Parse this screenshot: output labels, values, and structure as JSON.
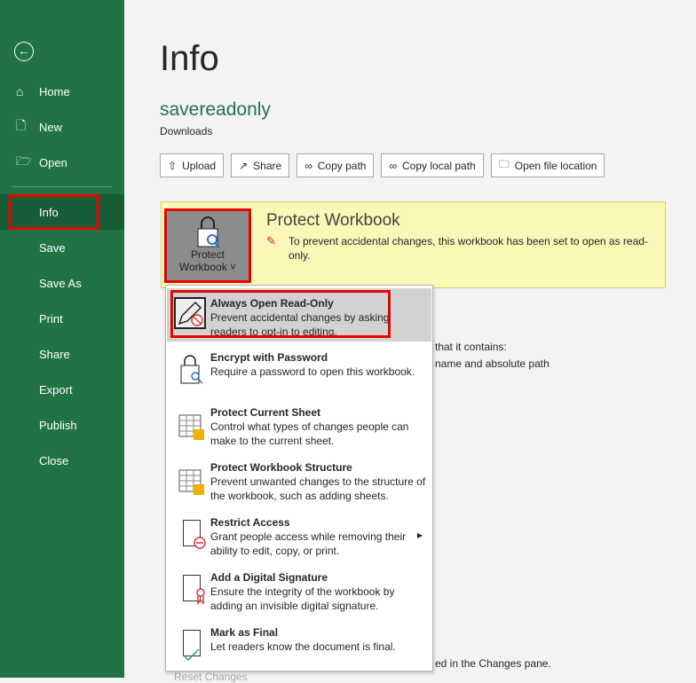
{
  "sidebar": {
    "back_icon": "arrow-left-icon",
    "items": [
      {
        "label": "Home",
        "icon": "home-icon"
      },
      {
        "label": "New",
        "icon": "new-doc-icon"
      },
      {
        "label": "Open",
        "icon": "folder-icon"
      },
      {
        "label": "Info"
      },
      {
        "label": "Save"
      },
      {
        "label": "Save As"
      },
      {
        "label": "Print"
      },
      {
        "label": "Share"
      },
      {
        "label": "Export"
      },
      {
        "label": "Publish"
      },
      {
        "label": "Close"
      }
    ],
    "selected": "Info"
  },
  "header": {
    "title": "Info",
    "file_name": "savereadonly",
    "location": "Downloads"
  },
  "actions": [
    "Upload",
    "Share",
    "Copy path",
    "Copy local path",
    "Open file location"
  ],
  "protect": {
    "button_line1": "Protect",
    "button_line2": "Workbook",
    "title": "Protect Workbook",
    "description": "To prevent accidental changes, this workbook has been set to open as read-only."
  },
  "background_text": {
    "line1": "that it contains:",
    "line2": "name and absolute path",
    "line3": "ed in the Changes pane.",
    "reset": "Reset Changes"
  },
  "menu": [
    {
      "title": "Always Open Read-Only",
      "desc": "Prevent accidental changes by asking readers to opt-in to editing.",
      "icon": "pencil-prohibited-icon"
    },
    {
      "title": "Encrypt with Password",
      "desc": "Require a password to open this workbook.",
      "icon": "lock-key-icon"
    },
    {
      "title": "Protect Current Sheet",
      "desc": "Control what types of changes people can make to the current sheet.",
      "icon": "sheet-lock-icon"
    },
    {
      "title": "Protect Workbook Structure",
      "desc": "Prevent unwanted changes to the structure of the workbook, such as adding sheets.",
      "icon": "workbook-lock-icon"
    },
    {
      "title": "Restrict Access",
      "desc": "Grant people access while removing their ability to edit, copy, or print.",
      "icon": "doc-restrict-icon"
    },
    {
      "title": "Add a Digital Signature",
      "desc": "Ensure the integrity of the workbook by adding an invisible digital signature.",
      "icon": "doc-ribbon-icon"
    },
    {
      "title": "Mark as Final",
      "desc": "Let readers know the document is final.",
      "icon": "doc-check-icon"
    }
  ],
  "colors": {
    "sidebar": "#217346",
    "selected": "#185c37",
    "highlight": "#e00000",
    "banner": "#fbf7b6"
  }
}
